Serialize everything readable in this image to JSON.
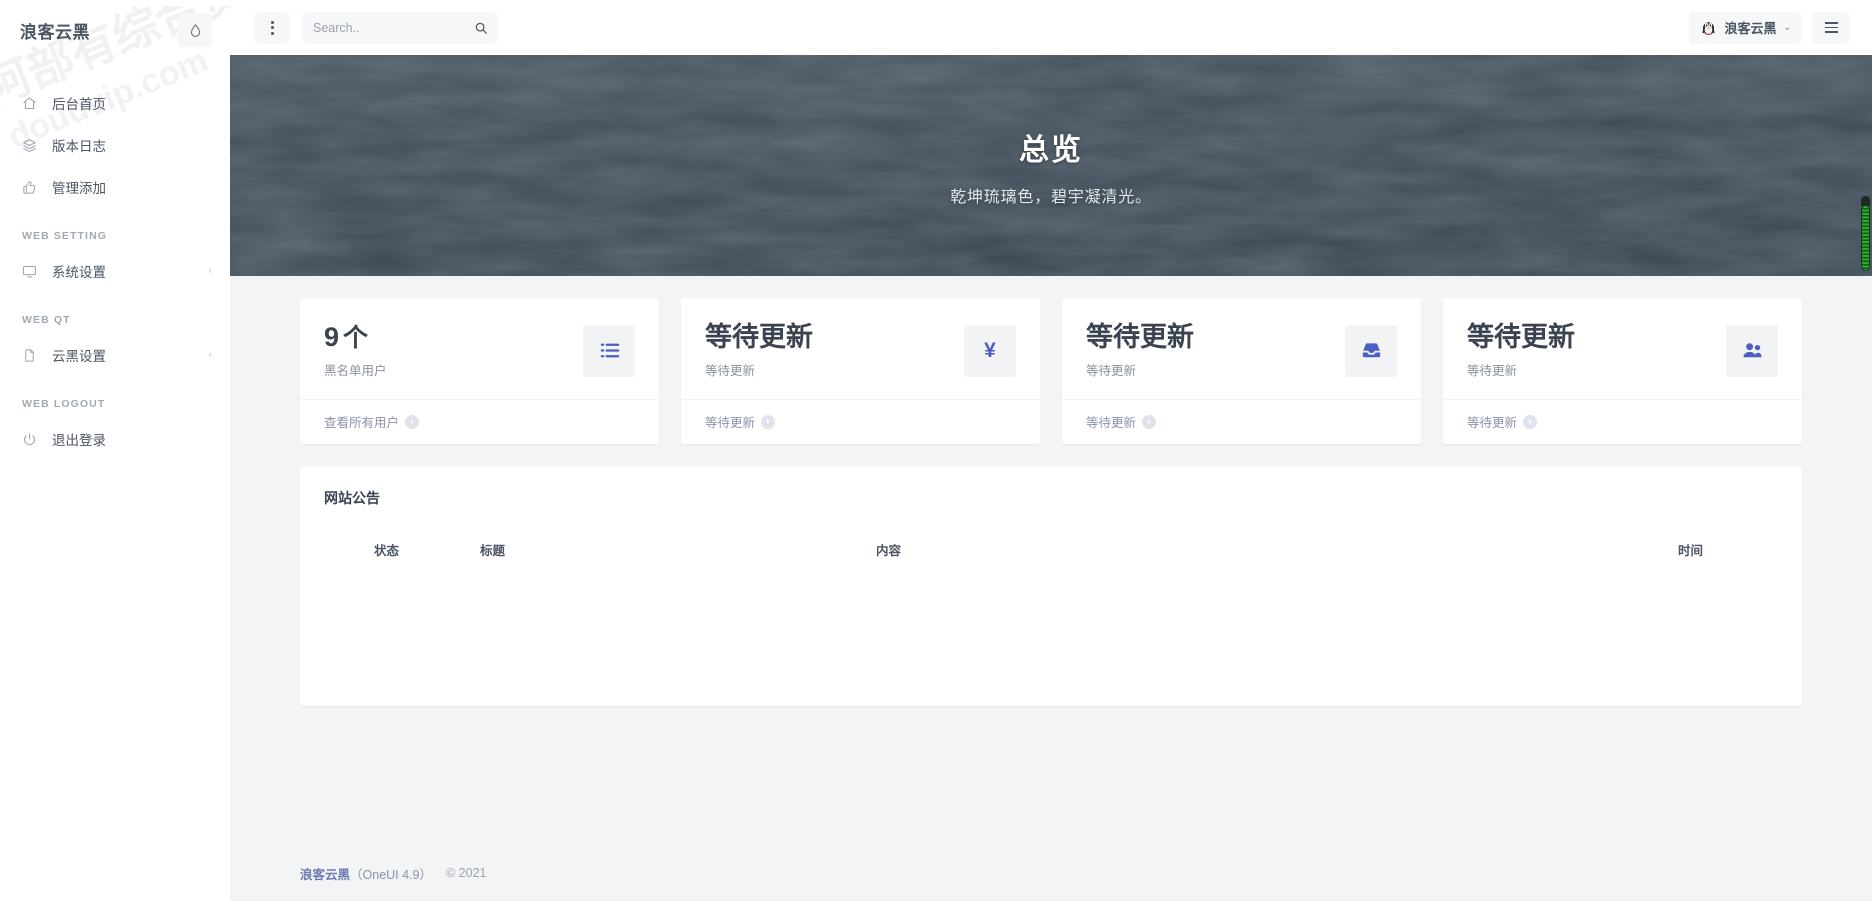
{
  "sidebar": {
    "brand": "浪客云黑",
    "drop_icon": "water-drop-icon",
    "watermark": "douuvip.com",
    "items": [
      {
        "label": "后台首页",
        "icon": "home-icon"
      },
      {
        "label": "版本日志",
        "icon": "layers-icon"
      },
      {
        "label": "管理添加",
        "icon": "thumbs-up-icon"
      }
    ],
    "sections": [
      {
        "title": "WEB SETTING",
        "items": [
          {
            "label": "系统设置",
            "icon": "monitor-icon",
            "chevron": "‹"
          }
        ]
      },
      {
        "title": "WEB QT",
        "items": [
          {
            "label": "云黑设置",
            "icon": "file-icon",
            "chevron": "‹"
          }
        ]
      },
      {
        "title": "WEB LOGOUT",
        "items": [
          {
            "label": "退出登录",
            "icon": "power-icon"
          }
        ]
      }
    ]
  },
  "header": {
    "kebab_icon": "kebab-menu-icon",
    "search": {
      "placeholder": "Search..",
      "value": "",
      "icon": "search-icon"
    },
    "user": {
      "name": "浪客云黑",
      "avatar_icon": "qq-penguin-avatar",
      "chevron": "⌄"
    },
    "burger_icon": "hamburger-menu-icon"
  },
  "hero": {
    "title": "总览",
    "subtitle": "乾坤琉璃色，碧宇凝清光。"
  },
  "cards": [
    {
      "value": "9",
      "unit": "个",
      "label": "黑名单用户",
      "icon": "list-icon",
      "footer_label": "查看所有用户",
      "footer_icon": "circle-arrow-right-icon"
    },
    {
      "value": "等待更新",
      "unit": "",
      "label": "等待更新",
      "icon": "yen-icon",
      "footer_label": "等待更新",
      "footer_icon": "circle-arrow-right-icon"
    },
    {
      "value": "等待更新",
      "unit": "",
      "label": "等待更新",
      "icon": "inbox-icon",
      "footer_label": "等待更新",
      "footer_icon": "circle-arrow-right-icon"
    },
    {
      "value": "等待更新",
      "unit": "",
      "label": "等待更新",
      "icon": "users-icon",
      "footer_label": "等待更新",
      "footer_icon": "circle-arrow-right-icon"
    }
  ],
  "panel": {
    "title": "网站公告",
    "columns": [
      "状态",
      "标题",
      "内容",
      "时间"
    ],
    "rows": []
  },
  "footer": {
    "brand": "浪客云黑",
    "version": "（OneUI 4.9）",
    "copyright": "© 2021"
  },
  "colors": {
    "accent_blue": "#4a5fc1",
    "link_blue": "#8b93ad",
    "hero_bg": "#3c4a55",
    "page_bg": "#f3f4f6",
    "scrollbar_green": "#2fa62f"
  }
}
